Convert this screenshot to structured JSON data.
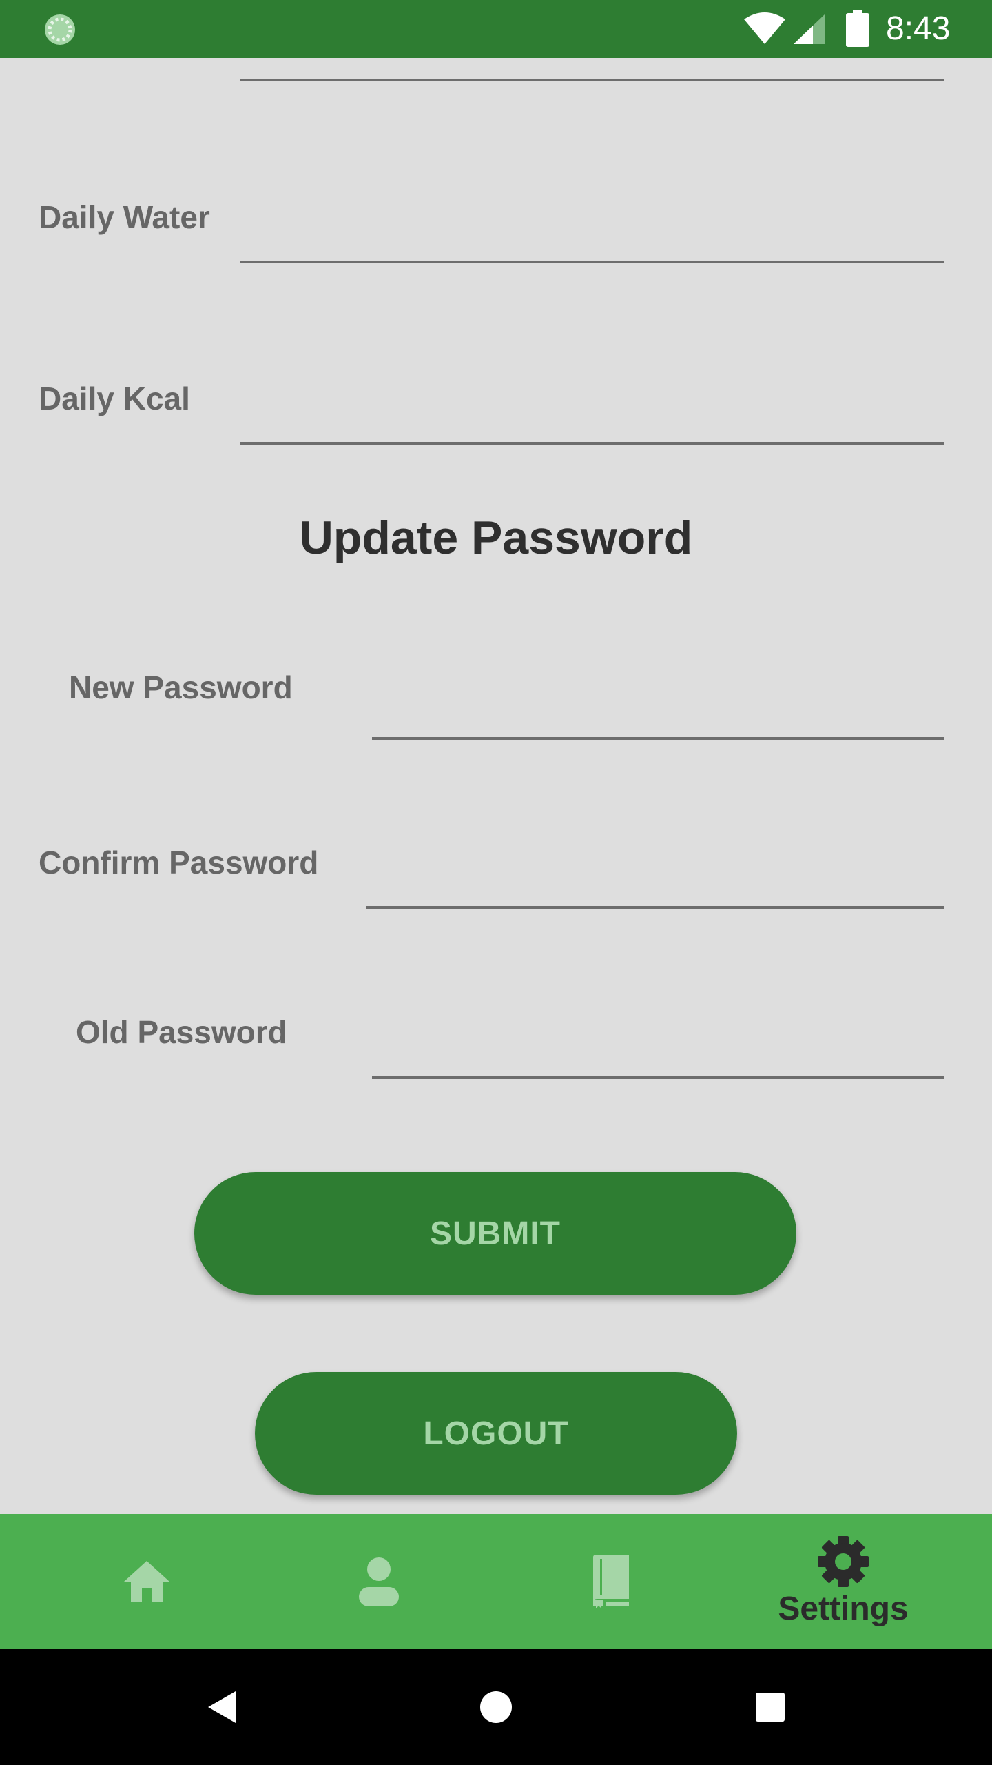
{
  "status_bar": {
    "time": "8:43",
    "icons": [
      "app-loading-icon",
      "wifi-icon",
      "signal-icon",
      "battery-icon"
    ]
  },
  "form": {
    "fields": [
      {
        "label": "",
        "value": ""
      },
      {
        "label": "Daily Water",
        "value": ""
      },
      {
        "label": "Daily Kcal",
        "value": ""
      }
    ],
    "update_password": {
      "title": "Update Password",
      "fields": [
        {
          "label": "New Password",
          "value": ""
        },
        {
          "label": "Confirm Password",
          "value": ""
        },
        {
          "label": "Old Password",
          "value": ""
        }
      ]
    },
    "submit_label": "SUBMIT",
    "logout_label": "LOGOUT"
  },
  "bottom_nav": {
    "items": [
      {
        "icon": "home-icon",
        "label": ""
      },
      {
        "icon": "person-icon",
        "label": ""
      },
      {
        "icon": "book-icon",
        "label": ""
      },
      {
        "icon": "gear-icon",
        "label": "Settings",
        "active": true
      }
    ]
  },
  "system_nav": {
    "buttons": [
      "back-icon",
      "home-circle-icon",
      "recents-icon"
    ]
  },
  "colors": {
    "primary_dark": "#2e7d32",
    "primary": "#4caf50",
    "button_text": "#a5d6a7",
    "background": "#dedede"
  }
}
